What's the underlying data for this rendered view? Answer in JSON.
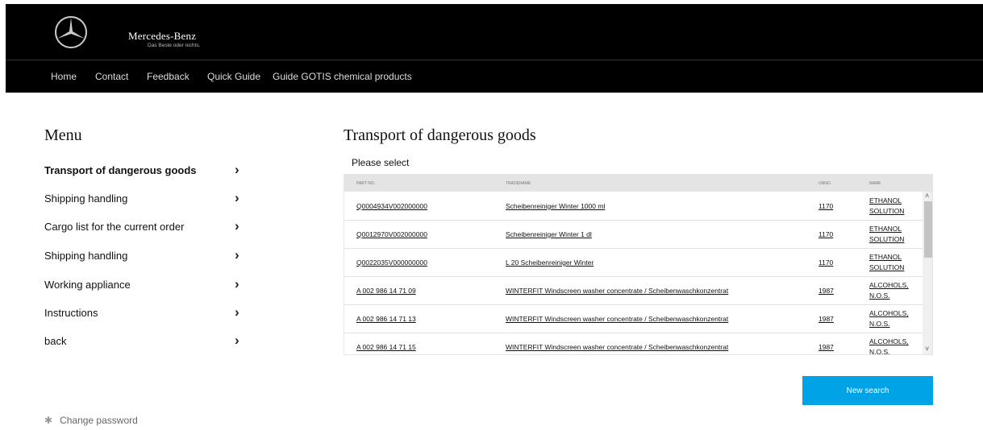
{
  "brand": {
    "name": "Mercedes-Benz",
    "tagline": "Das Beste oder nichts."
  },
  "nav": [
    {
      "label": "Home"
    },
    {
      "label": "Contact"
    },
    {
      "label": "Feedback"
    },
    {
      "label": "Quick Guide"
    },
    {
      "label": "Guide GOTIS chemical products"
    }
  ],
  "menu": {
    "title": "Menu",
    "items": [
      {
        "label": "Transport of dangerous goods",
        "active": true
      },
      {
        "label": "Shipping handling"
      },
      {
        "label": "Cargo list for the current order"
      },
      {
        "label": "Shipping handling"
      },
      {
        "label": "Working appliance"
      },
      {
        "label": "Instructions"
      },
      {
        "label": "back"
      }
    ]
  },
  "main": {
    "title": "Transport of dangerous goods",
    "subtitle": "Please select",
    "columns": [
      "PART NO.",
      "TRADENAME",
      "UNNO.",
      "NAME"
    ],
    "rows": [
      {
        "part": "Q0004934V002000000",
        "trade": "Scheibenreiniger Winter 1000 ml",
        "unno": "1170",
        "name": "ETHANOL SOLUTION"
      },
      {
        "part": "Q0012970V002000000",
        "trade": "Scheibenreiniger Winter 1 dl",
        "unno": "1170",
        "name": "ETHANOL SOLUTION"
      },
      {
        "part": "Q0022035V000000000",
        "trade": "L 20 Scheibenreiniger Winter",
        "unno": "1170",
        "name": "ETHANOL SOLUTION"
      },
      {
        "part": "A 002 986 14 71 09",
        "trade": "WINTERFIT Windscreen washer concentrate / Scheibenwaschkonzentrat",
        "unno": "1987",
        "name": "ALCOHOLS, N.O.S."
      },
      {
        "part": "A 002 986 14 71 13",
        "trade": "WINTERFIT Windscreen washer concentrate / Scheibenwaschkonzentrat",
        "unno": "1987",
        "name": "ALCOHOLS, N.O.S."
      },
      {
        "part": "A 002 986 14 71 15",
        "trade": "WINTERFIT Windscreen washer concentrate / Scheibenwaschkonzentrat",
        "unno": "1987",
        "name": "ALCOHOLS, N.O.S."
      }
    ],
    "new_search_label": "New search"
  },
  "footer": {
    "change_password": "Change password",
    "icon": "gear-icon"
  },
  "colors": {
    "header_bg": "#000000",
    "accent": "#00a4e6"
  }
}
